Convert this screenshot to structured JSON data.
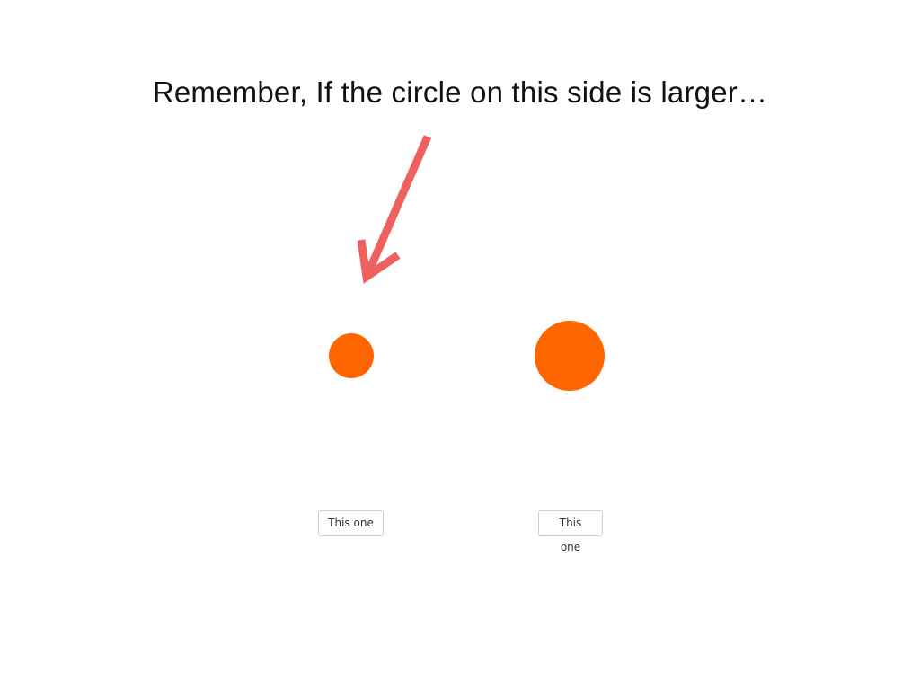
{
  "instruction": {
    "text": "Remember, If the circle on this side is larger…"
  },
  "annotation": {
    "arrow_icon": "arrow-down-left-icon",
    "arrow_color": "#ef6160"
  },
  "circles": {
    "color": "#ff6600",
    "left": {
      "relative_size": "small"
    },
    "right": {
      "relative_size": "large"
    }
  },
  "buttons": {
    "left_label": "This one",
    "right_label": "This one"
  }
}
